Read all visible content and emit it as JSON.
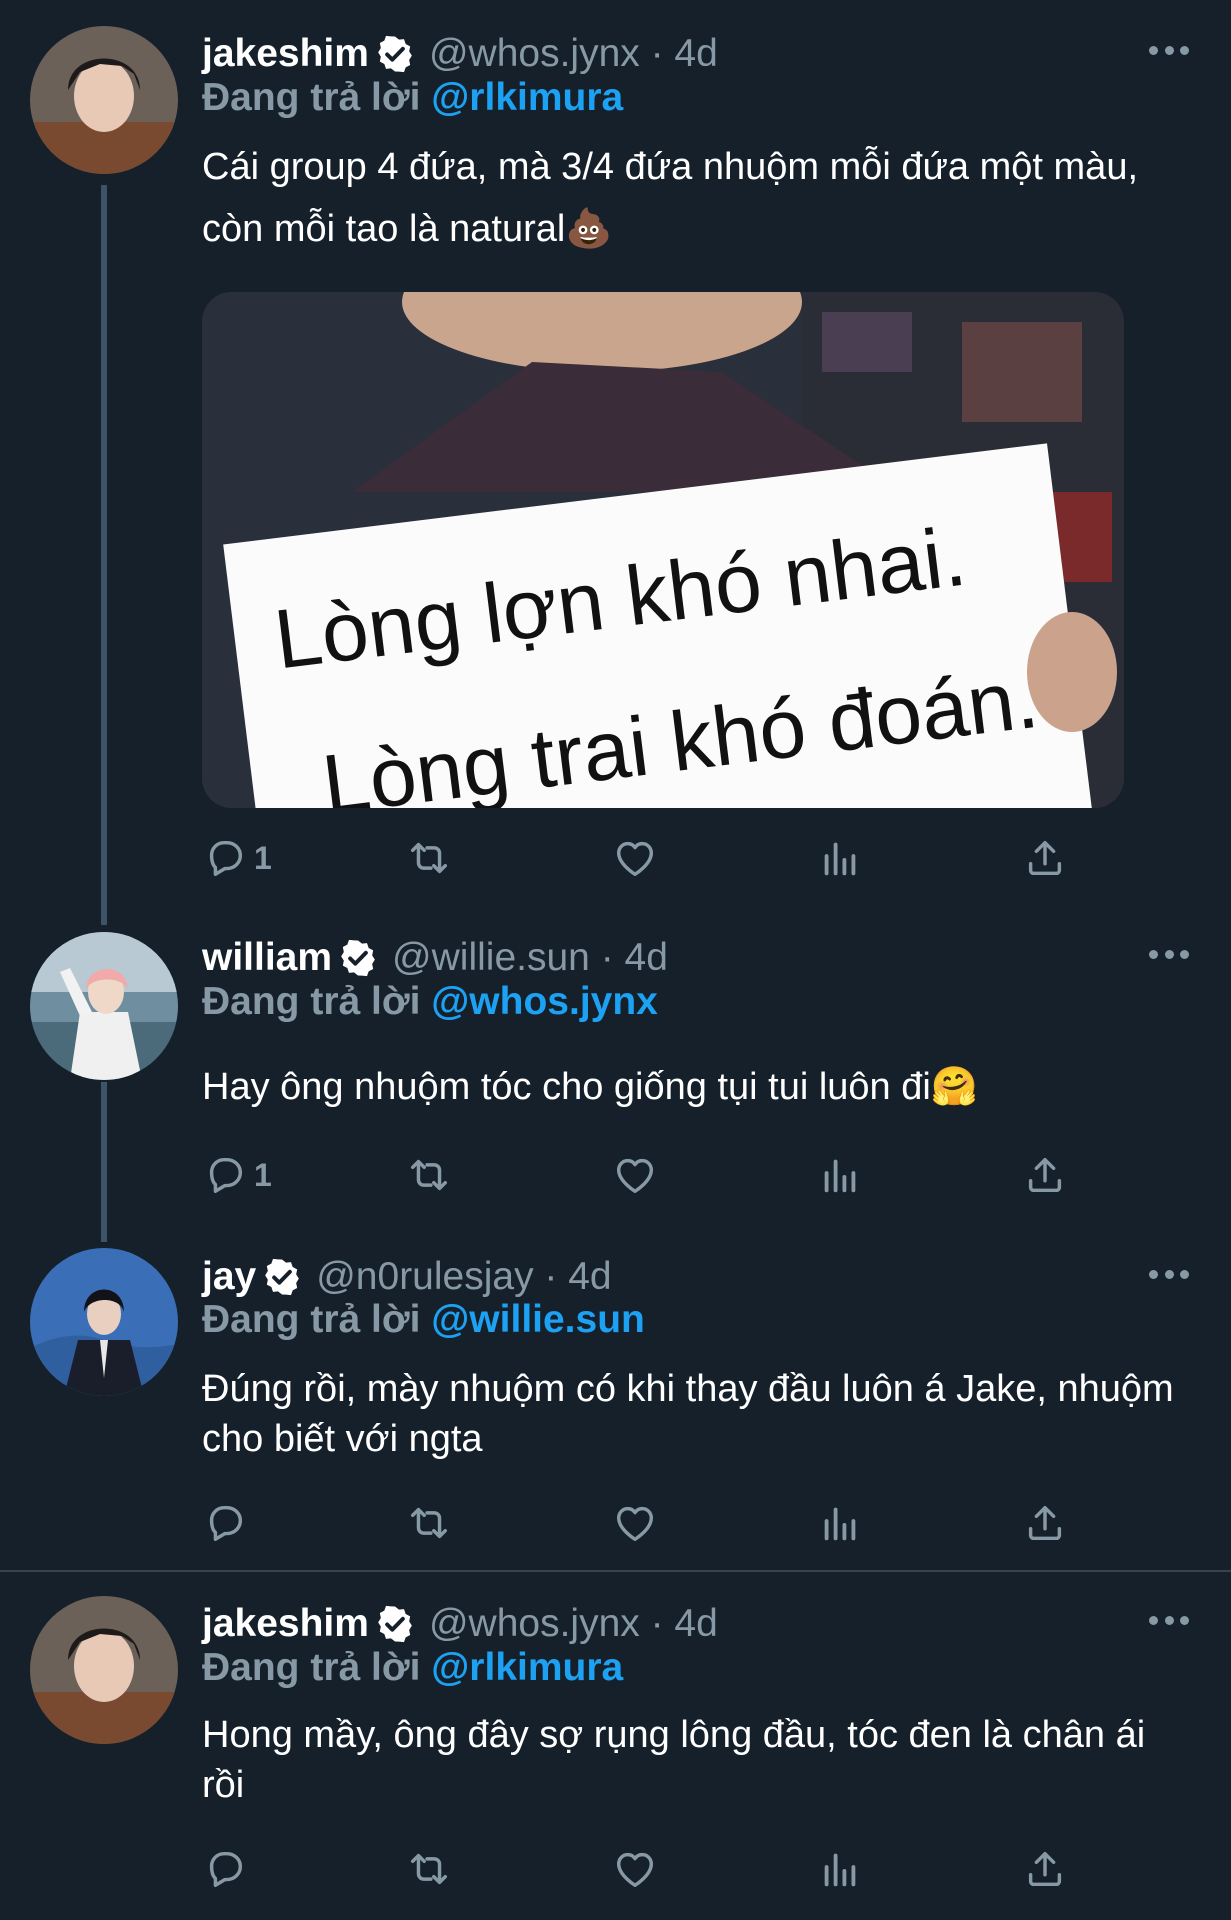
{
  "tweets": [
    {
      "name": "jakeshim",
      "handle": "@whos.jynx · 4d",
      "reply_prefix": "Đang trả lời",
      "reply_to": "@rlkimura",
      "text": "Cái group 4 đứa, mà 3/4 đứa nhuộm mỗi đứa một màu, còn mỗi tao là natural💩",
      "media_sign": [
        "Lòng lợn khó nhai.",
        "Lòng trai khó đoán."
      ],
      "reply_count": "1"
    },
    {
      "name": "william",
      "handle": "@willie.sun · 4d",
      "reply_prefix": "Đang trả lời",
      "reply_to": "@whos.jynx",
      "text": "Hay ông nhuộm tóc cho giống tụi tui luôn đi🤗",
      "reply_count": "1"
    },
    {
      "name": "jay",
      "handle": "@n0rulesjay · 4d",
      "reply_prefix": "Đang trả lời",
      "reply_to": "@willie.sun",
      "text": "Đúng rồi, mày nhuộm có khi thay đầu luôn á Jake, nhuộm cho biết với ngta",
      "reply_count": ""
    },
    {
      "name": "jakeshim",
      "handle": "@whos.jynx · 4d",
      "reply_prefix": "Đang trả lời",
      "reply_to": "@rlkimura",
      "text": "Hong mầy, ông đây sợ rụng lông đầu, tóc đen là chân ái rồi",
      "reply_count": ""
    }
  ],
  "icons": [
    "verified-icon",
    "more-icon",
    "reply-icon",
    "retweet-icon",
    "like-icon",
    "analytics-icon",
    "share-icon"
  ],
  "colors": {
    "background": "#15202b",
    "secondary": "#8899a6",
    "accent": "#1da1f2"
  }
}
